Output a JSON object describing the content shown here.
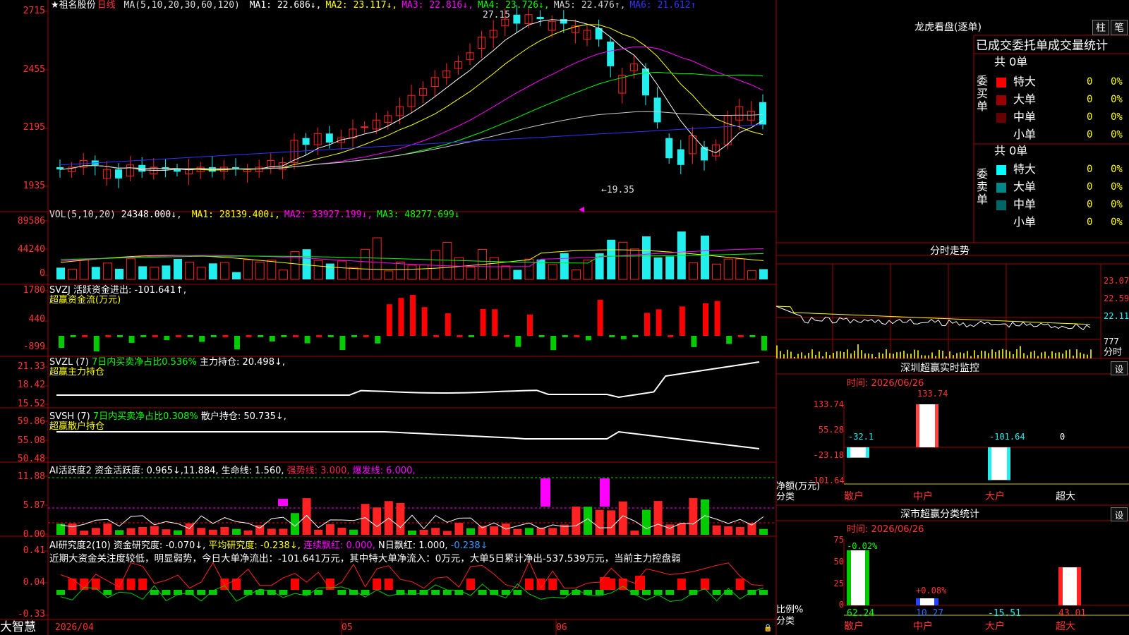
{
  "colors": {
    "up": "#ff2222",
    "down": "#22eeee",
    "grid": "#8a0000",
    "bg": "#000000",
    "axis_text": "#ff3333"
  },
  "stock": {
    "name": "★祖名股份",
    "period": "日线",
    "ma_label": "MA(5,10,20,30,60,120)",
    "ma": [
      {
        "label": "MA1:",
        "value": "22.686↓",
        "color": "#ffffff"
      },
      {
        "label": "MA2:",
        "value": "23.117↓",
        "color": "#ffff00"
      },
      {
        "label": "MA3:",
        "value": "22.816↓",
        "color": "#ff00ff"
      },
      {
        "label": "MA4:",
        "value": "23.726↓",
        "color": "#00ff00"
      },
      {
        "label": "MA5:",
        "value": "22.476↑",
        "color": "#cccccc"
      },
      {
        "label": "MA6:",
        "value": "21.612↑",
        "color": "#3333ff"
      }
    ],
    "y_labels": [
      "2715",
      "2455",
      "2195",
      "1935"
    ],
    "high_mark": "27.15",
    "low_mark": "←19.35"
  },
  "vol": {
    "header": "VOL(5,10,20)",
    "value": "24348.000↓",
    "ma": [
      {
        "label": "MA1:",
        "value": "28139.400↓",
        "color": "#ffff00"
      },
      {
        "label": "MA2:",
        "value": "33927.199↓",
        "color": "#ff00ff"
      },
      {
        "label": "MA3:",
        "value": "48277.699↓",
        "color": "#00ff00"
      }
    ],
    "y_labels": [
      "89586",
      "44240",
      "0"
    ]
  },
  "svzj": {
    "header": "SVZJ  活跃资金进出: -101.641↑,",
    "sub": "超赢资金流(万元)",
    "y_labels": [
      "1780",
      "440",
      "-899"
    ]
  },
  "svzl": {
    "header1": "SVZL (7) ",
    "header2": "7日内买卖净占比0.536%",
    "header3": " 主力持仓: 20.498↓,",
    "sub": "超赢主力持仓",
    "y_labels": [
      "21.33",
      "18.42",
      "15.52"
    ]
  },
  "svsh": {
    "header1": "SVSH (7) ",
    "header2": "7日内买卖净占比0.308%",
    "header3": " 散户持仓: 50.735↓,",
    "sub": "超赢散户持仓",
    "y_labels": [
      "59.86",
      "55.08",
      "50.48"
    ]
  },
  "ai1": {
    "h1": "AI活跃度2 资金活跃度: 0.965↓,",
    "h2": "11.884,",
    "h3": " 生命线: 1.560,",
    "h4": " 强势线: 3.000,",
    "h5": " 爆发线: 6.000,",
    "y_labels": [
      "11.88",
      "5.87",
      "0.00"
    ]
  },
  "ai2": {
    "h1": "AI研究度2(10) 资金研究度: -0.070↓,",
    "h2": " 平均研究度: -0.238↓,",
    "h3": " 连续飘红: 0.000,",
    "h4": " N日飘红: 1.000,",
    "h5": " -0.238↓",
    "note": "近期大资金关注度较低，明显弱势，今日大单净流出：-101.641万元，其中特大单净流入：0万元，大单5日累计净出-537.539万元，当前主力控盘弱",
    "y_labels": [
      "0.41",
      "0.04",
      "-0.33"
    ]
  },
  "bottom": {
    "brand": "大智慧",
    "dates": [
      "2026/04",
      "05",
      "06"
    ]
  },
  "longhu": {
    "title": "龙虎看盘(逐单)",
    "btn1": "柱",
    "btn2": "笔",
    "tabs": "已成交委托单成交量统计",
    "buy": {
      "side": "委买单",
      "total": "共 0单",
      "rows": [
        {
          "name": "特大",
          "n": "0",
          "p": "0%",
          "color": "#ff0000"
        },
        {
          "name": "大单",
          "n": "0",
          "p": "0%",
          "color": "#990000"
        },
        {
          "name": "中单",
          "n": "0",
          "p": "0%",
          "color": "#660000"
        },
        {
          "name": "小单",
          "n": "0",
          "p": "0%",
          "color": "#000000"
        }
      ]
    },
    "sell": {
      "side": "委卖单",
      "total": "共 0单",
      "rows": [
        {
          "name": "特大",
          "n": "0",
          "p": "0%",
          "color": "#00ffff"
        },
        {
          "name": "大单",
          "n": "0",
          "p": "0%",
          "color": "#008888"
        },
        {
          "name": "中单",
          "n": "0",
          "p": "0%",
          "color": "#006666"
        },
        {
          "name": "小单",
          "n": "0",
          "p": "0%",
          "color": "#000000"
        }
      ]
    }
  },
  "fenshi": {
    "title": "分时走势",
    "y_labels": [
      "23.07",
      "22.59",
      "22.11",
      "777"
    ],
    "unit": "分时"
  },
  "monitor": {
    "title": "深圳超赢实时监控",
    "btn": "设",
    "time": "时间: 2026/06/26",
    "y_labels": [
      "133.74",
      "55.28",
      "-23.18",
      "-101.64"
    ],
    "net_label": "净额(万元)",
    "class_label": "分类",
    "chart_data": {
      "type": "bar",
      "categories": [
        "散户",
        "中户",
        "大户",
        "超大"
      ],
      "values": [
        -32.1,
        133.74,
        -101.64,
        0
      ],
      "labels": [
        "-32.1",
        "133.74",
        "-101.64",
        "0"
      ],
      "ylim": [
        -101.64,
        133.74
      ]
    }
  },
  "stats": {
    "title": "深市超赢分类统计",
    "btn": "设",
    "time": "时间: 2026/06/26",
    "y_labels": [
      "75",
      "50",
      "25",
      "0"
    ],
    "ratio_label": "比例%",
    "class_label": "分类",
    "chart_data": {
      "type": "bar",
      "categories": [
        "散户",
        "中户",
        "大户",
        "超大"
      ],
      "values": [
        62.24,
        10.27,
        -15.51,
        43.01
      ],
      "value_labels": [
        "62.24",
        "10.27",
        "-15.51",
        "43.01"
      ],
      "top_labels": [
        "-0.02%",
        "+0.08%",
        "",
        ""
      ],
      "ylim": [
        0,
        75
      ]
    }
  }
}
